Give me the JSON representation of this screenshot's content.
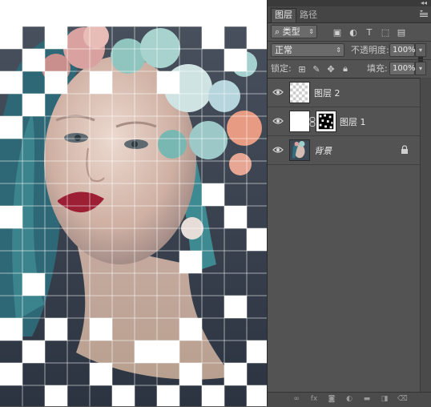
{
  "panel": {
    "tabs": [
      {
        "label": "图层",
        "active": true
      },
      {
        "label": "路径",
        "active": false
      }
    ],
    "filter": {
      "label": "类型"
    },
    "blend_mode": "正常",
    "opacity": {
      "label": "不透明度:",
      "value": "100%"
    },
    "lock_label": "锁定:",
    "fill": {
      "label": "填充:",
      "value": "100%"
    },
    "layers": [
      {
        "name": "图层 2",
        "visible": true,
        "type": "transparent"
      },
      {
        "name": "图层 1",
        "visible": true,
        "type": "masked"
      },
      {
        "name": "背景",
        "visible": true,
        "type": "background",
        "locked": true
      }
    ],
    "bottom_icons": [
      "link-icon",
      "fx-icon",
      "mask-icon",
      "adjustment-icon",
      "folder-icon",
      "new-layer-icon",
      "trash-icon"
    ]
  },
  "colors": {
    "panel_bg": "#535353",
    "canvas_bg": "#ffffff",
    "hair": "#2f6f7e",
    "lips": "#9c1f34"
  }
}
